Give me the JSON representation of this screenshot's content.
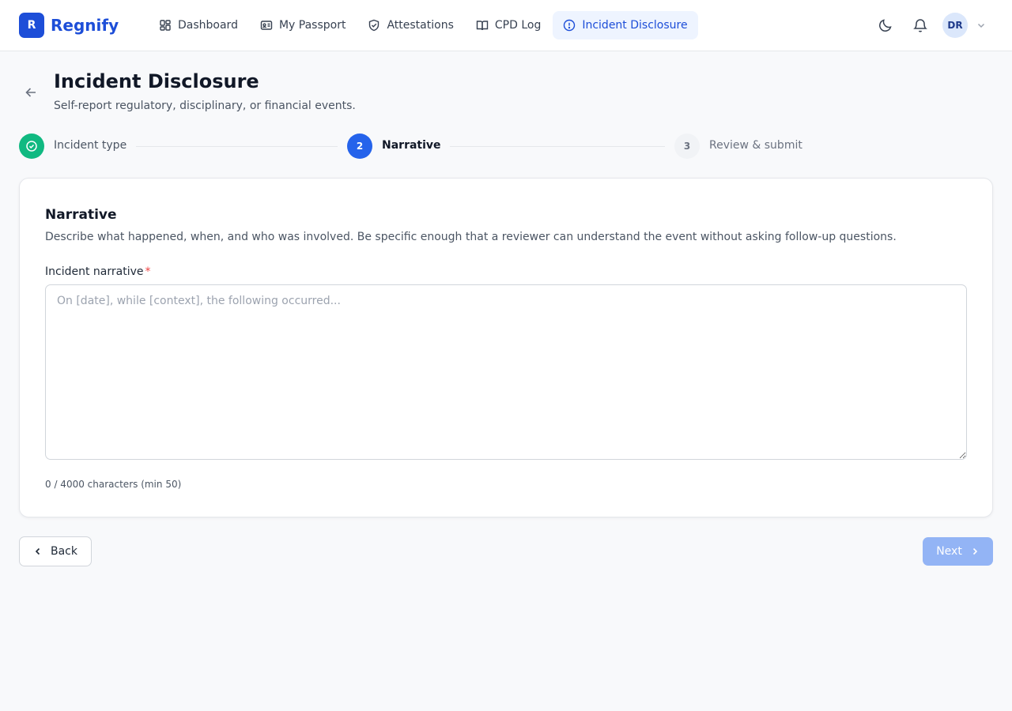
{
  "app": {
    "brand_initial": "R",
    "brand_name": "Regnify"
  },
  "nav": {
    "items": [
      {
        "label": "Dashboard",
        "icon": "grid-icon"
      },
      {
        "label": "My Passport",
        "icon": "id-card-icon"
      },
      {
        "label": "Attestations",
        "icon": "shield-check-icon"
      },
      {
        "label": "CPD Log",
        "icon": "book-open-icon"
      },
      {
        "label": "Incident Disclosure",
        "icon": "alert-circle-icon",
        "active": true
      }
    ]
  },
  "header": {
    "avatar_initials": "DR",
    "icons": [
      "moon-icon",
      "bell-icon",
      "chevron-down-icon"
    ]
  },
  "page": {
    "title": "Incident Disclosure",
    "subtitle": "Self-report regulatory, disciplinary, or financial events."
  },
  "stepper": {
    "steps": [
      {
        "number": "1",
        "label": "Incident type",
        "status": "complete"
      },
      {
        "number": "2",
        "label": "Narrative",
        "status": "current"
      },
      {
        "number": "3",
        "label": "Review & submit",
        "status": "pending"
      }
    ]
  },
  "form": {
    "section_title": "Narrative",
    "section_description": "Describe what happened, when, and who was involved. Be specific enough that a reviewer can understand the event without asking follow-up questions.",
    "field_label": "Incident narrative",
    "required_marker": "*",
    "value": "",
    "placeholder": "On [date], while [context], the following occurred...",
    "char_count": "0 / 4000 characters (min 50)"
  },
  "actions": {
    "back_label": "Back",
    "next_label": "Next"
  },
  "colors": {
    "brand": "#1d4ed8",
    "step_complete": "#10b981",
    "step_current": "#2563eb",
    "next_disabled": "#93b4f5",
    "required": "#ef4444"
  }
}
